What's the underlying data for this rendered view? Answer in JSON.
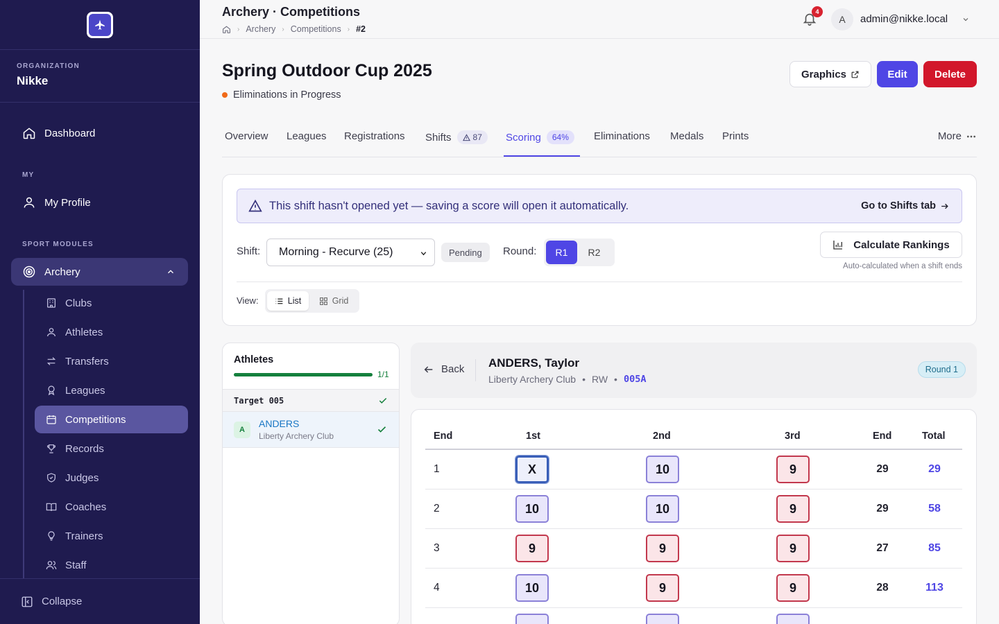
{
  "org": {
    "label": "ORGANIZATION",
    "name": "Nikke"
  },
  "nav": {
    "dashboard": "Dashboard",
    "my_label": "MY",
    "my_profile": "My Profile",
    "sport_label": "SPORT MODULES",
    "archery": "Archery",
    "subitems": [
      "Clubs",
      "Athletes",
      "Transfers",
      "Leagues",
      "Competitions",
      "Records",
      "Judges",
      "Coaches",
      "Trainers",
      "Staff"
    ],
    "collapse": "Collapse"
  },
  "header": {
    "title": "Archery · Competitions",
    "breadcrumb": [
      "Archery",
      "Competitions",
      "#2"
    ],
    "notifications": "4",
    "avatar_initial": "A",
    "user": "admin@nikke.local"
  },
  "page": {
    "title": "Spring Outdoor Cup 2025",
    "status": "Eliminations in Progress",
    "graphics_label": "Graphics",
    "edit_label": "Edit",
    "delete_label": "Delete"
  },
  "tabs": {
    "overview": "Overview",
    "leagues": "Leagues",
    "registrations": "Registrations",
    "shifts": "Shifts",
    "shifts_count": "87",
    "scoring": "Scoring",
    "scoring_pct": "64%",
    "eliminations": "Eliminations",
    "medals": "Medals",
    "prints": "Prints",
    "more": "More"
  },
  "scoring": {
    "notice": "This shift hasn't opened yet — saving a score will open it automatically.",
    "notice_link": "Go to Shifts tab",
    "shift_label": "Shift:",
    "shift_value": "Morning - Recurve (25)",
    "shift_status": "Pending",
    "round_label": "Round:",
    "round_options": [
      "R1",
      "R2"
    ],
    "round_selected": "R1",
    "calc_label": "Calculate Rankings",
    "calc_note": "Auto-calculated when a shift ends",
    "view_label": "View:",
    "view_list": "List",
    "view_grid": "Grid",
    "view_selected": "List"
  },
  "athletes_panel": {
    "title": "Athletes",
    "progress_text": "1/1",
    "progress_fraction": 1.0,
    "target": "Target 005",
    "athlete_initial": "A",
    "athlete_name": "ANDERS",
    "athlete_club": "Liberty Archery Club"
  },
  "athlete": {
    "back": "Back",
    "name": "ANDERS, Taylor",
    "club": "Liberty Archery Club",
    "division": "RW",
    "code": "005A",
    "round_badge": "Round 1"
  },
  "score_table": {
    "headers": [
      "End",
      "1st",
      "2nd",
      "3rd",
      "End",
      "Total"
    ],
    "rows": [
      {
        "end": "1",
        "arrows": [
          "X",
          "10",
          "9"
        ],
        "colors": [
          "selected",
          "blue",
          "red"
        ],
        "end_total": "29",
        "total": "29"
      },
      {
        "end": "2",
        "arrows": [
          "10",
          "10",
          "9"
        ],
        "colors": [
          "blue",
          "blue",
          "red"
        ],
        "end_total": "29",
        "total": "58"
      },
      {
        "end": "3",
        "arrows": [
          "9",
          "9",
          "9"
        ],
        "colors": [
          "red",
          "red",
          "red"
        ],
        "end_total": "27",
        "total": "85"
      },
      {
        "end": "4",
        "arrows": [
          "10",
          "9",
          "9"
        ],
        "colors": [
          "blue",
          "red",
          "red"
        ],
        "end_total": "28",
        "total": "113"
      }
    ]
  },
  "colors": {
    "accent": "#4f46e5",
    "sidebar": "#1f1b4f",
    "danger": "#d2172b",
    "success": "#15803d"
  }
}
